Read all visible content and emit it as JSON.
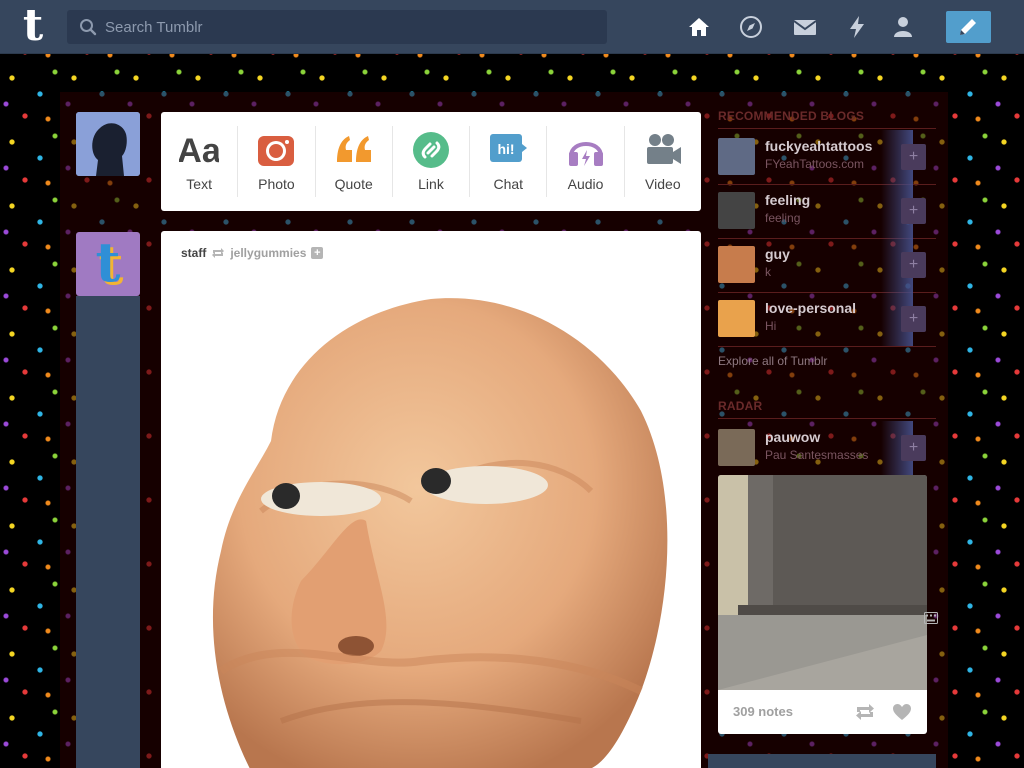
{
  "topbar": {
    "logo": "t",
    "search_placeholder": "Search Tumblr",
    "nav_icons": [
      "home-icon",
      "explore-icon",
      "mail-icon",
      "activity-icon",
      "account-icon"
    ],
    "compose_icon": "pencil-icon"
  },
  "post_types": [
    {
      "label": "Text",
      "icon": "text-icon",
      "color": "#444444"
    },
    {
      "label": "Photo",
      "icon": "camera-icon",
      "color": "#d95e40"
    },
    {
      "label": "Quote",
      "icon": "quote-icon",
      "color": "#f2992e"
    },
    {
      "label": "Link",
      "icon": "link-icon",
      "color": "#56bc8a"
    },
    {
      "label": "Chat",
      "icon": "chat-icon",
      "color": "#529ecc"
    },
    {
      "label": "Audio",
      "icon": "headphones-icon",
      "color": "#a77dc2"
    },
    {
      "label": "Video",
      "icon": "video-camera-icon",
      "color": "#748089"
    }
  ],
  "post": {
    "author": "staff",
    "reblogged_from": "jellygummies"
  },
  "sidebar": {
    "recommended_title": "RECOMMENDED BLOGS",
    "blogs": [
      {
        "name": "fuckyeahtattoos",
        "desc": "FYeahTattoos.com",
        "color": "#6a6a8a"
      },
      {
        "name": "feeling",
        "desc": "feeling",
        "color": "#555555"
      },
      {
        "name": "guy",
        "desc": "k",
        "color": "#c77c4c"
      },
      {
        "name": "love-personal",
        "desc": "Hi",
        "color": "#e9a24c"
      }
    ],
    "explore": "Explore all of Tumblr",
    "radar_title": "RADAR",
    "radar_blog": {
      "name": "pauwow",
      "desc": "Pau Santesmasses"
    },
    "radar_notes": "309 notes"
  }
}
